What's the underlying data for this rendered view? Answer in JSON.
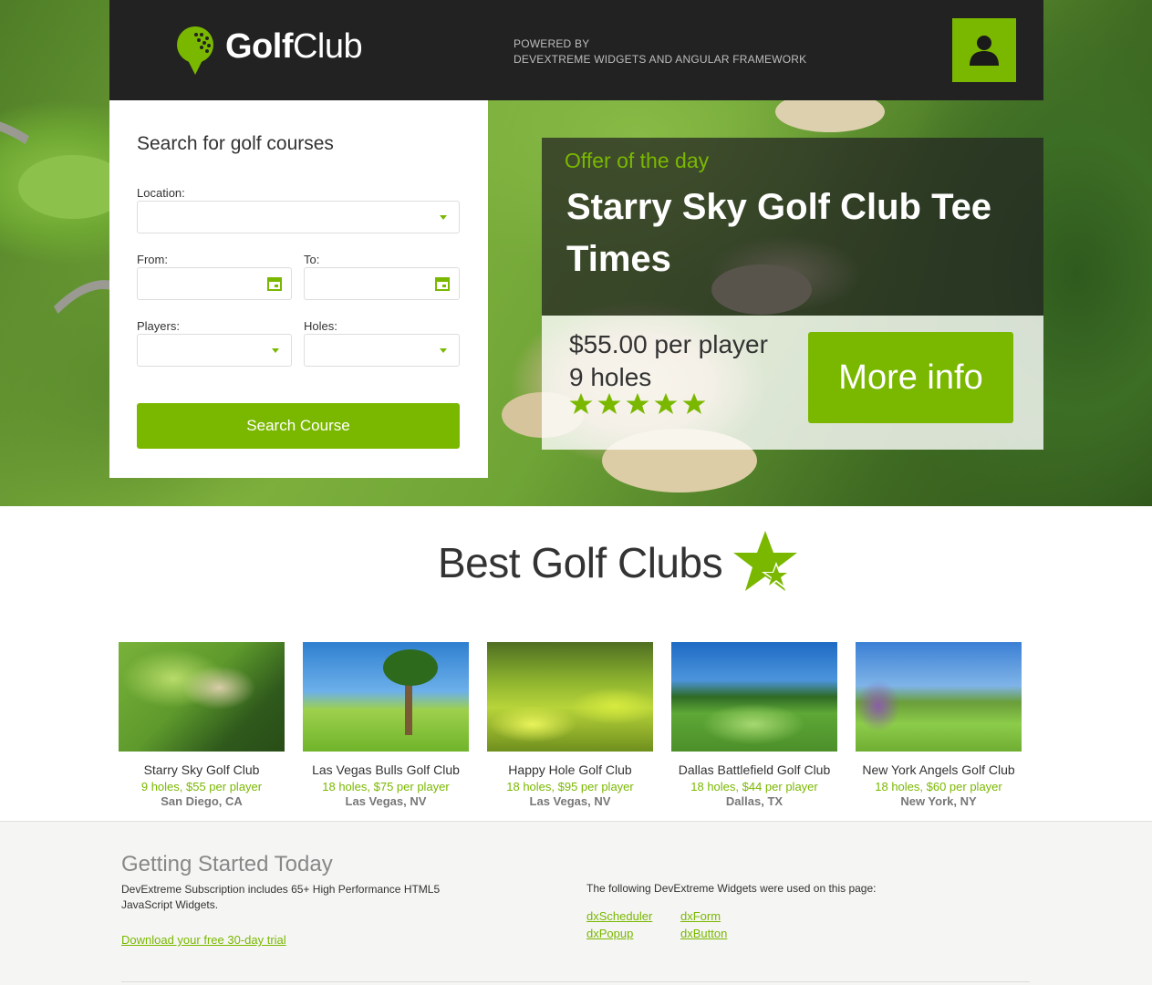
{
  "header": {
    "logo_bold": "Golf",
    "logo_light": "Club",
    "powered_line1": "POWERED BY",
    "powered_line2": "DEVEXTREME WIDGETS AND ANGULAR FRAMEWORK",
    "user_icon": "user-icon"
  },
  "search": {
    "title": "Search for golf courses",
    "location_label": "Location:",
    "location_value": "",
    "from_label": "From:",
    "from_value": "",
    "to_label": "To:",
    "to_value": "",
    "players_label": "Players:",
    "players_value": "",
    "holes_label": "Holes:",
    "holes_value": "",
    "button_label": "Search Course"
  },
  "offer": {
    "label": "Offer of the day",
    "title": "Starry Sky Golf Club Tee Times",
    "price": "$55.00 per player",
    "holes": "9 holes",
    "rating": 5,
    "button_label": "More info"
  },
  "best": {
    "title": "Best Golf Clubs",
    "clubs": [
      {
        "name": "Starry Sky Golf Club",
        "price": "9 holes, $55 per player",
        "location": "San Diego, CA"
      },
      {
        "name": "Las Vegas Bulls Golf Club",
        "price": "18 holes, $75 per player",
        "location": "Las Vegas, NV"
      },
      {
        "name": "Happy Hole Golf Club",
        "price": "18 holes, $95 per player",
        "location": "Las Vegas, NV"
      },
      {
        "name": "Dallas Battlefield Golf Club",
        "price": "18 holes, $44 per player",
        "location": "Dallas, TX"
      },
      {
        "name": "New York Angels Golf Club",
        "price": "18 holes, $60 per player",
        "location": "New York, NY"
      }
    ]
  },
  "footer": {
    "title": "Getting Started Today",
    "description": "DevExtreme Subscription includes 65+ High Performance HTML5 JavaScript Widgets.",
    "trial_link": "Download your free 30-day trial",
    "widgets_text": "The following DevExtreme Widgets were used on this page:",
    "widgets": [
      "dxScheduler",
      "dxForm",
      "dxPopup",
      "dxButton"
    ]
  },
  "colors": {
    "accent": "#7ab800",
    "topbar": "#222222"
  }
}
